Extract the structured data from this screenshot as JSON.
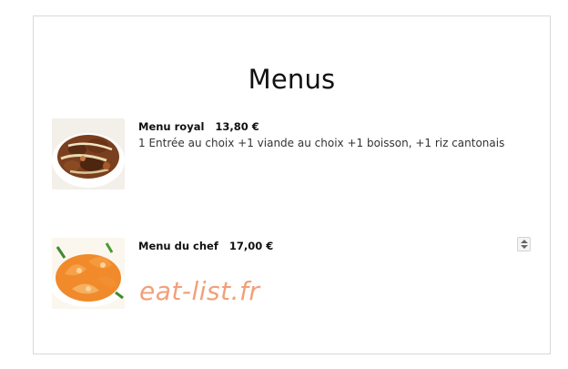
{
  "page": {
    "title": "Menus"
  },
  "menus": [
    {
      "name": "Menu royal",
      "price": "13,80 €",
      "description": "1 Entrée au choix +1 viande au choix +1 boisson, +1 riz cantonais",
      "image": "beef-stir-fry-photo"
    },
    {
      "name": "Menu du chef",
      "price": "17,00 €",
      "description": "",
      "image": "shrimp-dish-photo"
    }
  ],
  "watermark": "eat-list.fr",
  "controls": {
    "stepper_icon": "up-down-spinner-icon"
  },
  "colors": {
    "watermark": "#f2a07a",
    "text": "#111111",
    "border": "#d9d9d9"
  }
}
